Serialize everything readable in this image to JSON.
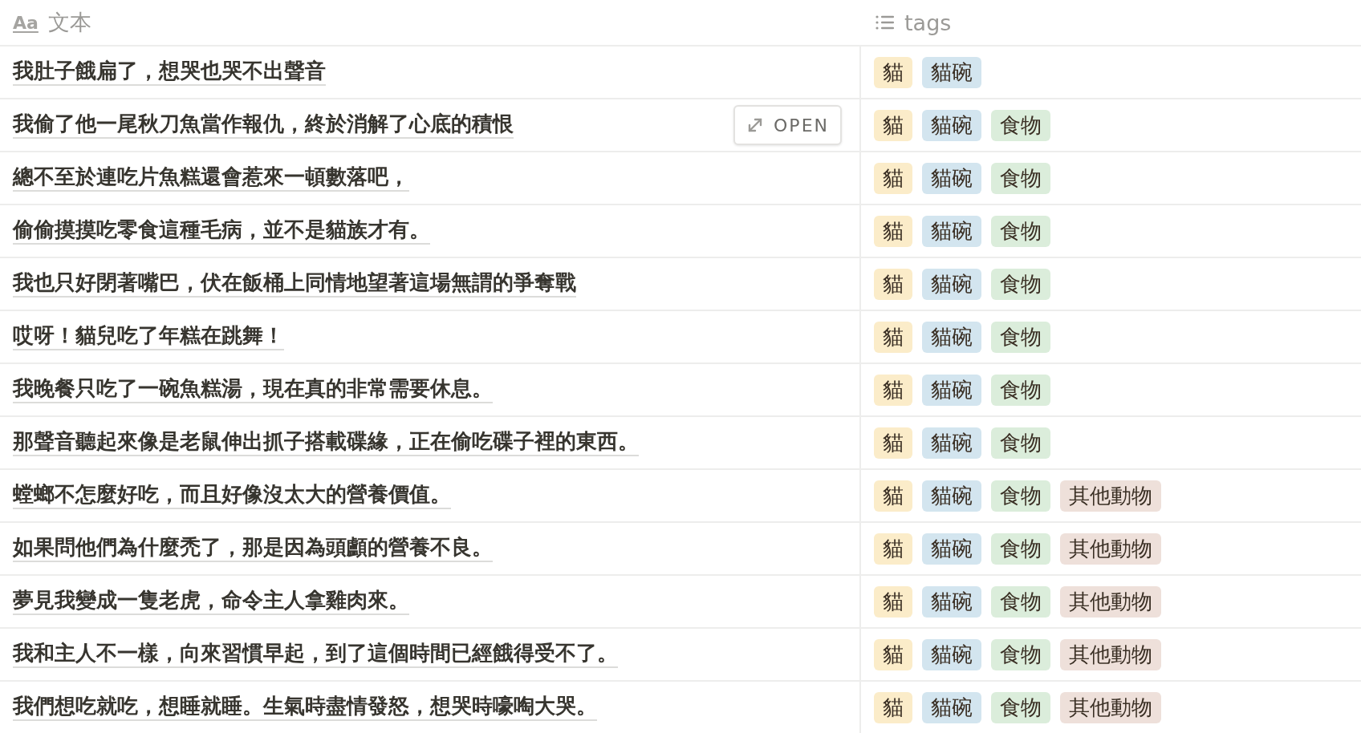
{
  "columns": [
    {
      "icon": "Aa",
      "label": "文本",
      "kind": "text"
    },
    {
      "label": "tags",
      "kind": "list"
    }
  ],
  "rows": [
    {
      "text": "我肚子餓扁了，想哭也哭不出聲音",
      "tags": [
        {
          "label": "貓",
          "color": "#fbecc9"
        },
        {
          "label": "貓碗",
          "color": "#d3e5ef"
        }
      ]
    },
    {
      "text": "我偷了他一尾秋刀魚當作報仇，終於消解了心底的積恨",
      "open_button": "OPEN",
      "tags": [
        {
          "label": "貓",
          "color": "#fbecc9"
        },
        {
          "label": "貓碗",
          "color": "#d3e5ef"
        },
        {
          "label": "食物",
          "color": "#dbeddb"
        }
      ]
    },
    {
      "text": "總不至於連吃片魚糕還會惹來一頓數落吧，",
      "tags": [
        {
          "label": "貓",
          "color": "#fbecc9"
        },
        {
          "label": "貓碗",
          "color": "#d3e5ef"
        },
        {
          "label": "食物",
          "color": "#dbeddb"
        }
      ]
    },
    {
      "text": "偷偷摸摸吃零食這種毛病，並不是貓族才有。",
      "tags": [
        {
          "label": "貓",
          "color": "#fbecc9"
        },
        {
          "label": "貓碗",
          "color": "#d3e5ef"
        },
        {
          "label": "食物",
          "color": "#dbeddb"
        }
      ]
    },
    {
      "text": "我也只好閉著嘴巴，伏在飯桶上同情地望著這場無謂的爭奪戰",
      "tags": [
        {
          "label": "貓",
          "color": "#fbecc9"
        },
        {
          "label": "貓碗",
          "color": "#d3e5ef"
        },
        {
          "label": "食物",
          "color": "#dbeddb"
        }
      ]
    },
    {
      "text": "哎呀！貓兒吃了年糕在跳舞！",
      "tags": [
        {
          "label": "貓",
          "color": "#fbecc9"
        },
        {
          "label": "貓碗",
          "color": "#d3e5ef"
        },
        {
          "label": "食物",
          "color": "#dbeddb"
        }
      ]
    },
    {
      "text": "我晚餐只吃了一碗魚糕湯，現在真的非常需要休息。",
      "tags": [
        {
          "label": "貓",
          "color": "#fbecc9"
        },
        {
          "label": "貓碗",
          "color": "#d3e5ef"
        },
        {
          "label": "食物",
          "color": "#dbeddb"
        }
      ]
    },
    {
      "text": "那聲音聽起來像是老鼠伸出抓子搭載碟緣，正在偷吃碟子裡的東西。",
      "tags": [
        {
          "label": "貓",
          "color": "#fbecc9"
        },
        {
          "label": "貓碗",
          "color": "#d3e5ef"
        },
        {
          "label": "食物",
          "color": "#dbeddb"
        }
      ]
    },
    {
      "text": "螳螂不怎麼好吃，而且好像沒太大的營養價值。",
      "tags": [
        {
          "label": "貓",
          "color": "#fbecc9"
        },
        {
          "label": "貓碗",
          "color": "#d3e5ef"
        },
        {
          "label": "食物",
          "color": "#dbeddb"
        },
        {
          "label": "其他動物",
          "color": "#eee0da"
        }
      ]
    },
    {
      "text": "如果問他們為什麼禿了，那是因為頭顱的營養不良。",
      "tags": [
        {
          "label": "貓",
          "color": "#fbecc9"
        },
        {
          "label": "貓碗",
          "color": "#d3e5ef"
        },
        {
          "label": "食物",
          "color": "#dbeddb"
        },
        {
          "label": "其他動物",
          "color": "#eee0da"
        }
      ]
    },
    {
      "text": "夢見我變成一隻老虎，命令主人拿雞肉來。",
      "tags": [
        {
          "label": "貓",
          "color": "#fbecc9"
        },
        {
          "label": "貓碗",
          "color": "#d3e5ef"
        },
        {
          "label": "食物",
          "color": "#dbeddb"
        },
        {
          "label": "其他動物",
          "color": "#eee0da"
        }
      ]
    },
    {
      "text": "我和主人不一樣，向來習慣早起，到了這個時間已經餓得受不了。",
      "tags": [
        {
          "label": "貓",
          "color": "#fbecc9"
        },
        {
          "label": "貓碗",
          "color": "#d3e5ef"
        },
        {
          "label": "食物",
          "color": "#dbeddb"
        },
        {
          "label": "其他動物",
          "color": "#eee0da"
        }
      ]
    },
    {
      "text": "我們想吃就吃，想睡就睡。生氣時盡情發怒，想哭時嚎啕大哭。",
      "tags": [
        {
          "label": "貓",
          "color": "#fbecc9"
        },
        {
          "label": "貓碗",
          "color": "#d3e5ef"
        },
        {
          "label": "食物",
          "color": "#dbeddb"
        },
        {
          "label": "其他動物",
          "color": "#eee0da"
        }
      ]
    }
  ]
}
